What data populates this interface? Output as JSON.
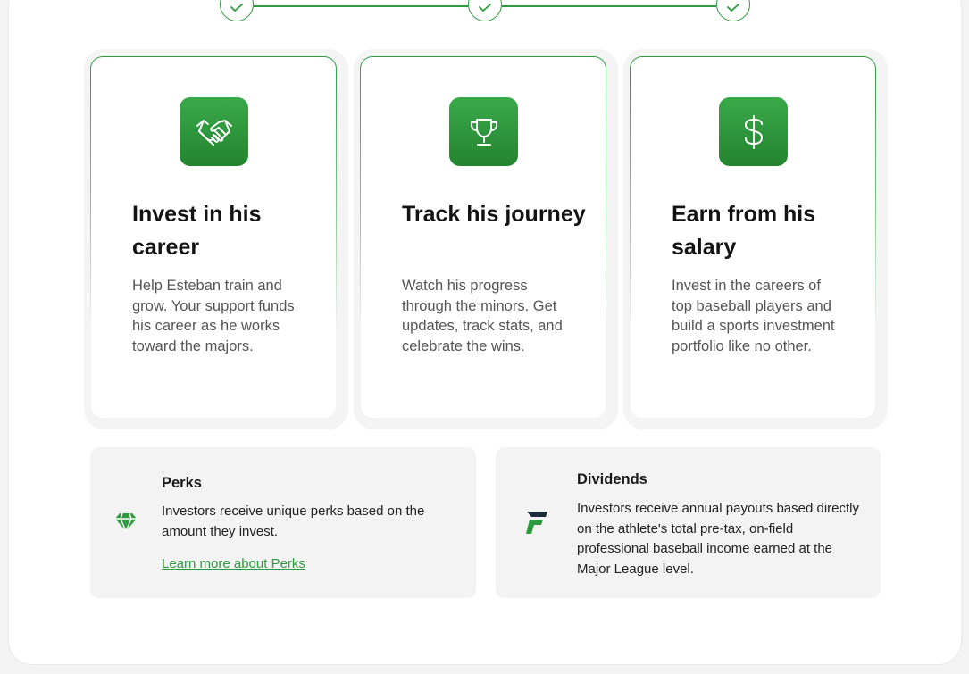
{
  "cards": [
    {
      "icon": "handshake-icon",
      "title": "Invest in his career",
      "description": "Help Esteban train and grow. Your support funds his career as he works toward the majors."
    },
    {
      "icon": "trophy-icon",
      "title": "Track his journey",
      "description": "Watch his progress through the minors. Get updates, track stats, and celebrate the wins."
    },
    {
      "icon": "dollar-icon",
      "title": "Earn from his salary",
      "description": "Invest in the careers of top baseball players and build a sports investment portfolio like no other."
    }
  ],
  "perks": {
    "icon": "diamond-icon",
    "title": "Perks",
    "text": "Investors receive unique perks based on the amount they invest.",
    "link": "Learn more about Perks"
  },
  "dividends": {
    "icon": "brand-f-logo-icon",
    "title": "Dividends",
    "text": "Investors receive annual payouts based directly on the athlete's total pre-tax, on-field professional baseball income earned at the Major League level."
  },
  "colors": {
    "accent": "#2e9a3f",
    "icon_bg": "#2a8f37",
    "info_bg": "#f3f3f3"
  }
}
